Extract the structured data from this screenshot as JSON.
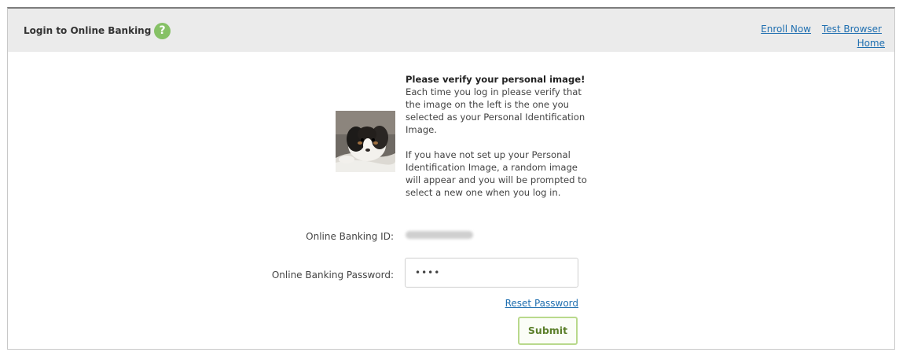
{
  "header": {
    "title": "Login to Online Banking",
    "help_icon": "?",
    "links": {
      "enroll": "Enroll Now",
      "test_browser": "Test Browser",
      "home": "Home"
    }
  },
  "verify": {
    "title": "Please verify your personal image!",
    "paragraph1": "Each time you log in please verify that the image on the left is the one you selected as your Personal Identification Image.",
    "paragraph2": "If you have not set up your Personal Identification Image, a random image will appear and you will be prompted to select a new one when you log in."
  },
  "form": {
    "id_label": "Online Banking ID:",
    "password_label": "Online Banking Password:",
    "password_value": "••••",
    "reset_label": "Reset Password",
    "submit_label": "Submit"
  },
  "colors": {
    "header_bg": "#ebebeb",
    "link": "#1f6fb0",
    "help_icon_bg": "#86c166",
    "submit_border": "#b9d98c"
  }
}
